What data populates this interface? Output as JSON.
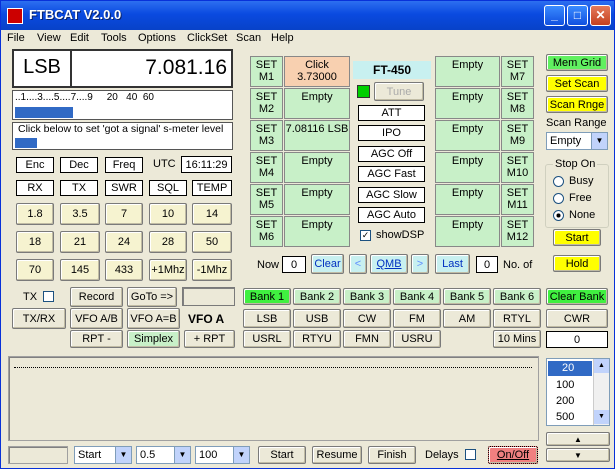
{
  "title": "FTBCAT V2.0.0",
  "menu": [
    "File",
    "View",
    "Edit",
    "Tools",
    "Options",
    "ClickSet",
    "Scan",
    "Help"
  ],
  "mode": "LSB",
  "freq": "7.081.16",
  "smeter_scale": "..1....3....5....7....9     20   40  60",
  "smeter_hint": "Click below to set 'got a signal' s-meter level",
  "enc": "Enc",
  "dec": "Dec",
  "freqbtn": "Freq",
  "utc_label": "UTC",
  "utc": "16:11:29",
  "row_rx": [
    "RX",
    "TX",
    "SWR",
    "SQL",
    "TEMP"
  ],
  "bands1": [
    "1.8",
    "3.5",
    "7",
    "10",
    "14"
  ],
  "bands2": [
    "18",
    "21",
    "24",
    "28",
    "50"
  ],
  "bands3": [
    "70",
    "145",
    "433",
    "+1Mhz",
    "-1Mhz"
  ],
  "tx_label": "TX",
  "record": "Record",
  "goto": "GoTo =>",
  "txrx": "TX/RX",
  "vfoab": "VFO A/B",
  "vfoaeqb": "VFO A=B",
  "vfoa": "VFO A",
  "rptm": "RPT -",
  "simplex": "Simplex",
  "rptp": "+ RPT",
  "mem_left": [
    {
      "set": "SET M1",
      "val": "Click 3.73000"
    },
    {
      "set": "SET M2",
      "val": "Empty"
    },
    {
      "set": "SET M3",
      "val": "7.08116 LSB"
    },
    {
      "set": "SET M4",
      "val": "Empty"
    },
    {
      "set": "SET M5",
      "val": "Empty"
    },
    {
      "set": "SET M6",
      "val": "Empty"
    }
  ],
  "mem_right": [
    {
      "set": "SET M7",
      "val": "Empty"
    },
    {
      "set": "SET M8",
      "val": "Empty"
    },
    {
      "set": "SET M9",
      "val": "Empty"
    },
    {
      "set": "SET M10",
      "val": "Empty"
    },
    {
      "set": "SET M11",
      "val": "Empty"
    },
    {
      "set": "SET M12",
      "val": "Empty"
    }
  ],
  "radio_name": "FT-450",
  "tune": "Tune",
  "ctrl": [
    "ATT",
    "IPO",
    "AGC Off",
    "AGC Fast",
    "AGC Slow",
    "AGC Auto"
  ],
  "showdsp": "showDSP",
  "now": "Now",
  "now_val": "0",
  "clear": "Clear",
  "qmb": "QMB",
  "last": "Last",
  "last_val": "0",
  "noof": "No. of",
  "memgrid": "Mem Grid",
  "setscan": "Set Scan",
  "scanrnge": "Scan Rnge",
  "scanrange_label": "Scan Range",
  "scanrange_val": "Empty",
  "stopon": "Stop On",
  "busy": "Busy",
  "free": "Free",
  "none": "None",
  "start": "Start",
  "hold": "Hold",
  "banks": [
    "Bank 1",
    "Bank 2",
    "Bank 3",
    "Bank 4",
    "Bank 5",
    "Bank 6"
  ],
  "clearbank": "Clear Bank",
  "modes1": [
    "LSB",
    "USB",
    "CW",
    "FM",
    "AM",
    "RTYL"
  ],
  "cwr": "CWR",
  "modes2": [
    "USRL",
    "RTYU",
    "FMN",
    "USRU"
  ],
  "tenmins": "10 Mins",
  "tenval": "0",
  "list": [
    "20",
    "100",
    "200",
    "500"
  ],
  "bottom": {
    "start_sel": "Start",
    "step_sel": "0.5",
    "val_sel": "100",
    "start": "Start",
    "resume": "Resume",
    "finish": "Finish",
    "delays": "Delays",
    "onoff": "On/Off"
  },
  "colors": {
    "title": "#0a4ae0",
    "green": "#00e000",
    "yellow": "#ffff00",
    "memset": "#c8f0c8",
    "cream": "#f6f3d0"
  }
}
